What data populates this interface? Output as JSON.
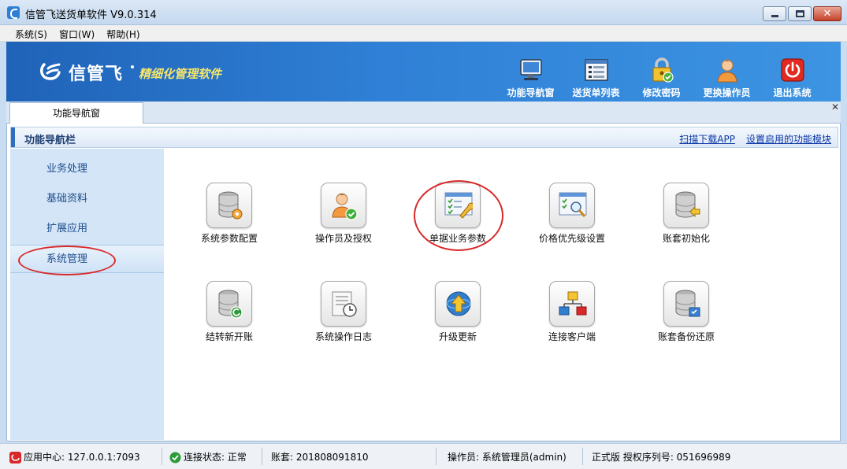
{
  "window": {
    "title": "信管飞送货单软件 V9.0.314"
  },
  "menu": [
    {
      "label": "系统(S)"
    },
    {
      "label": "窗口(W)"
    },
    {
      "label": "帮助(H)"
    }
  ],
  "banner": {
    "logo_text": "信管飞",
    "slogan": "精细化管理软件"
  },
  "toolbar": [
    {
      "label": "功能导航窗",
      "icon": "monitor-icon"
    },
    {
      "label": "送货单列表",
      "icon": "list-icon"
    },
    {
      "label": "修改密码",
      "icon": "lock-icon"
    },
    {
      "label": "更换操作员",
      "icon": "user-icon"
    },
    {
      "label": "退出系统",
      "icon": "power-icon"
    }
  ],
  "tabs": [
    {
      "label": "功能导航窗"
    }
  ],
  "panel": {
    "title": "功能导航栏",
    "links": [
      {
        "label": "扫描下载APP"
      },
      {
        "label": "设置启用的功能模块"
      }
    ]
  },
  "sidebar": [
    {
      "label": "业务处理"
    },
    {
      "label": "基础资料"
    },
    {
      "label": "扩展应用"
    },
    {
      "label": "系统管理",
      "active": true
    }
  ],
  "functions": [
    {
      "label": "系统参数配置",
      "icon": "database-gear-icon"
    },
    {
      "label": "操作员及授权",
      "icon": "user-check-icon"
    },
    {
      "label": "单据业务参数",
      "icon": "document-wrench-icon"
    },
    {
      "label": "价格优先级设置",
      "icon": "document-search-icon"
    },
    {
      "label": "账套初始化",
      "icon": "database-arrow-icon"
    },
    {
      "label": "结转新开账",
      "icon": "database-refresh-icon"
    },
    {
      "label": "系统操作日志",
      "icon": "log-clock-icon"
    },
    {
      "label": "升级更新",
      "icon": "upgrade-globe-icon"
    },
    {
      "label": "连接客户端",
      "icon": "network-icon"
    },
    {
      "label": "账套备份还原",
      "icon": "database-backup-icon"
    }
  ],
  "status": {
    "app_center": "应用中心: 127.0.0.1:7093",
    "connection": "连接状态: 正常",
    "account_set": "账套: 201808091810",
    "operator": "操作员: 系统管理员(admin)",
    "license": "正式版 授权序列号: 051696989"
  },
  "colors": {
    "banner": "#2f80d6",
    "sidebar": "#d4e5f7",
    "annotation": "#d82a2a",
    "slogan": "#f6e66b"
  }
}
